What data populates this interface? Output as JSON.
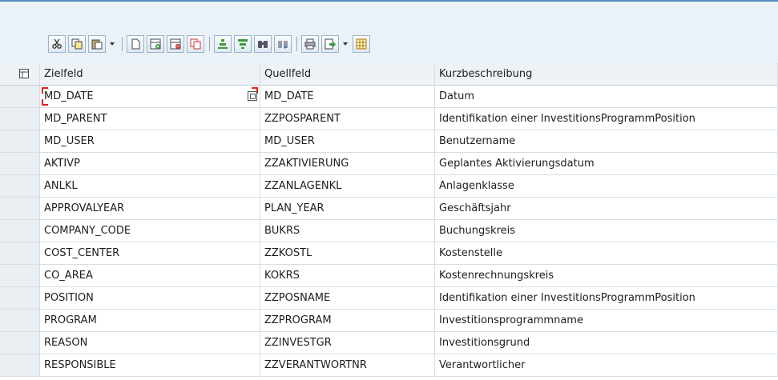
{
  "toolbar": {
    "buttons": [
      {
        "name": "cut-button",
        "icon": "scissors-icon"
      },
      {
        "name": "copy-button",
        "icon": "copy-icon"
      },
      {
        "name": "paste-button",
        "icon": "paste-icon"
      },
      {
        "name": "new-row-button",
        "icon": "blank-page-icon"
      },
      {
        "name": "insert-row-button",
        "icon": "insert-row-icon"
      },
      {
        "name": "delete-row-button",
        "icon": "delete-row-icon"
      },
      {
        "name": "duplicate-row-button",
        "icon": "duplicate-icon"
      },
      {
        "name": "sort-ascending-button",
        "icon": "sort-icon"
      },
      {
        "name": "filter-button",
        "icon": "filter-icon"
      },
      {
        "name": "find-button",
        "icon": "binoculars-icon"
      },
      {
        "name": "find-next-button",
        "icon": "binoculars-next-icon"
      },
      {
        "name": "print-button",
        "icon": "printer-icon"
      },
      {
        "name": "export-button",
        "icon": "export-icon"
      },
      {
        "name": "layout-button",
        "icon": "grid-layout-icon"
      }
    ]
  },
  "columns": [
    "Zielfeld",
    "Quellfeld",
    "Kurzbeschreibung"
  ],
  "rows": [
    [
      "MD_DATE",
      "MD_DATE",
      "Datum"
    ],
    [
      "MD_PARENT",
      "ZZPOSPARENT",
      "Identifikation einer InvestitionsProgrammPosition"
    ],
    [
      "MD_USER",
      "MD_USER",
      "Benutzername"
    ],
    [
      "AKTIVP",
      "ZZAKTIVIERUNG",
      "Geplantes Aktivierungsdatum"
    ],
    [
      "ANLKL",
      "ZZANLAGENKL",
      "Anlagenklasse"
    ],
    [
      "APPROVALYEAR",
      "PLAN_YEAR",
      "Geschäftsjahr"
    ],
    [
      "COMPANY_CODE",
      "BUKRS",
      "Buchungskreis"
    ],
    [
      "COST_CENTER",
      "ZZKOSTL",
      "Kostenstelle"
    ],
    [
      "CO_AREA",
      "KOKRS",
      "Kostenrechnungskreis"
    ],
    [
      "POSITION",
      "ZZPOSNAME",
      "Identifikation einer InvestitionsProgrammPosition"
    ],
    [
      "PROGRAM",
      "ZZPROGRAM",
      "Investitionsprogrammname"
    ],
    [
      "REASON",
      "ZZINVESTGR",
      "Investitionsgrund"
    ],
    [
      "RESPONSIBLE",
      "ZZVERANTWORTNR",
      "Verantwortlicher"
    ]
  ],
  "colors": {
    "accent": "#5b8cb7",
    "focus": "#dd2222"
  }
}
